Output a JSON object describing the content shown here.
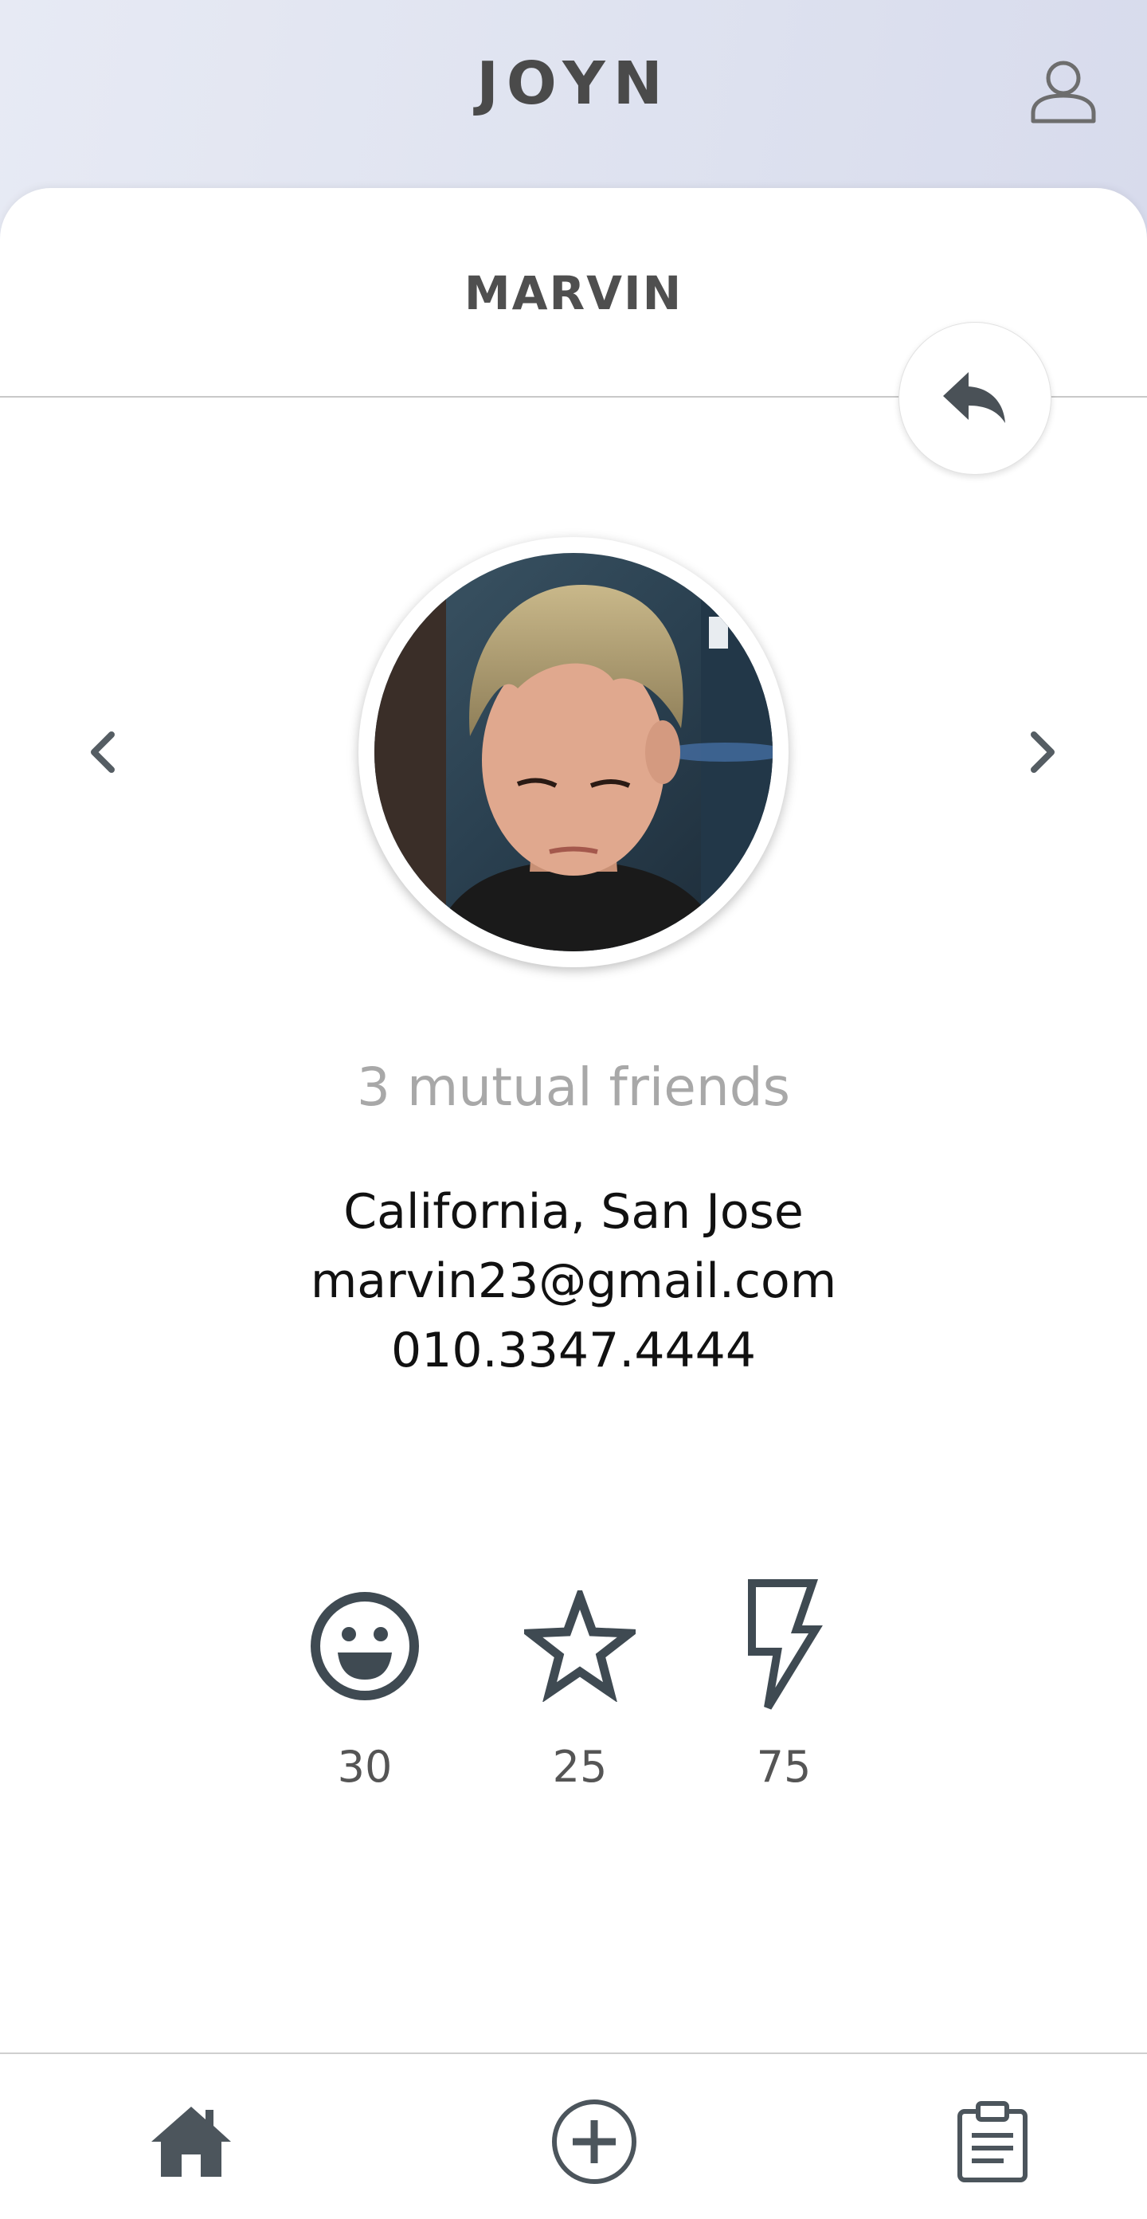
{
  "app": {
    "title": "JOYN",
    "icons": {
      "profile": "user-outline-icon"
    }
  },
  "profile": {
    "name": "MARVIN",
    "mutual_friends": "3 mutual friends",
    "location": "California, San Jose",
    "email": "marvin23@gmail.com",
    "phone": "010.3347.4444",
    "avatar": "user-photo"
  },
  "controls": {
    "back_icon": "reply-arrow-icon",
    "prev_icon": "chevron-left-icon",
    "next_icon": "chevron-right-icon"
  },
  "stats": [
    {
      "icon": "smiley-face-icon",
      "value": "30"
    },
    {
      "icon": "star-icon",
      "value": "25"
    },
    {
      "icon": "lightning-bolt-icon",
      "value": "75"
    }
  ],
  "bottom_nav": {
    "items": [
      {
        "icon": "home-icon"
      },
      {
        "icon": "add-circle-icon"
      },
      {
        "icon": "clipboard-icon"
      }
    ]
  },
  "colors": {
    "header_gradient_start": "#e7eaf4",
    "header_gradient_end": "#d3d6ea",
    "text_dark": "#4a4a4a",
    "icon_dark": "#3f4a52",
    "muted_text": "#a8a8a8"
  }
}
